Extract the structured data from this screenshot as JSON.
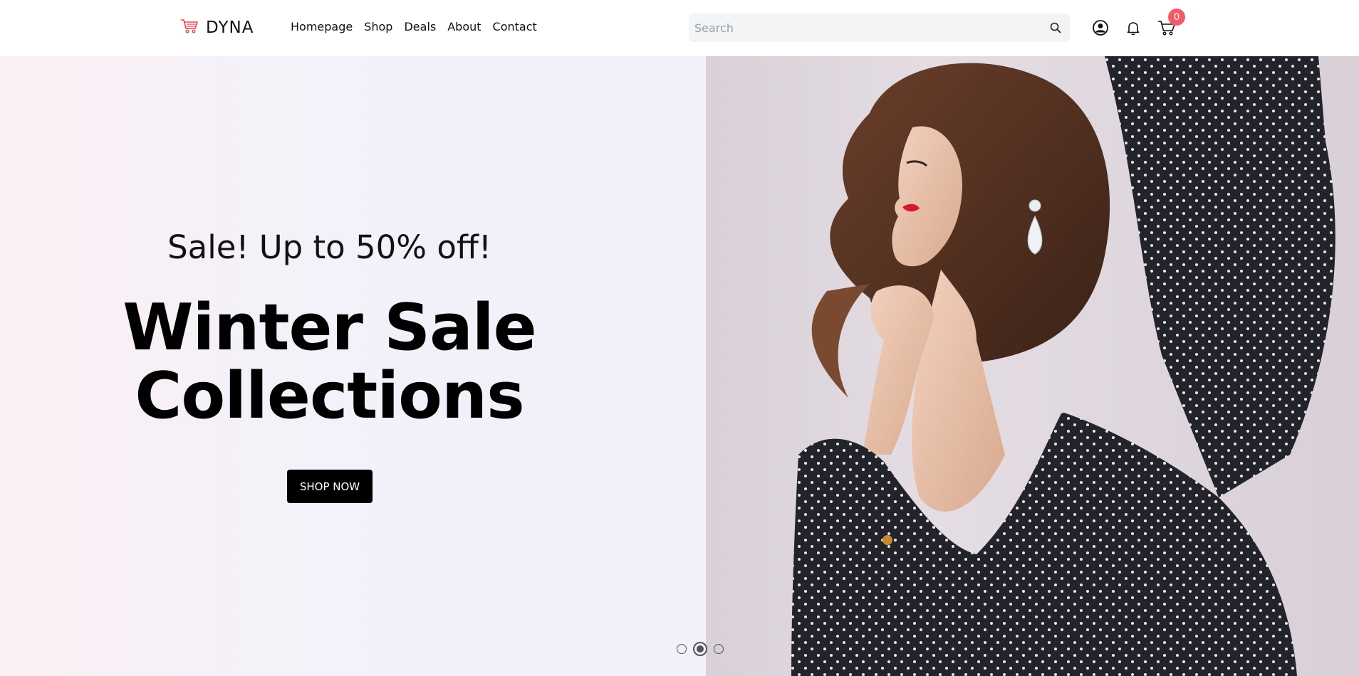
{
  "brand": {
    "name": "DYNA",
    "logo_icon": "shopping-cart-icon",
    "logo_color": "#e5484d"
  },
  "nav": {
    "items": [
      {
        "label": "Homepage"
      },
      {
        "label": "Shop"
      },
      {
        "label": "Deals"
      },
      {
        "label": "About"
      },
      {
        "label": "Contact"
      }
    ]
  },
  "search": {
    "placeholder": "Search",
    "value": "",
    "icon": "search-icon"
  },
  "header_icons": {
    "account": "user-circle-icon",
    "notifications": "bell-icon",
    "cart": "cart-icon",
    "cart_count": "0",
    "badge_color": "#f45b6a"
  },
  "hero": {
    "subtitle": "Sale! Up to 50% off!",
    "title_line1": "Winter Sale",
    "title_line2": "Collections",
    "cta_label": "SHOP NOW",
    "image_alt": "model-in-polka-dot-blouse",
    "slides_total": 3,
    "active_slide": 2
  }
}
